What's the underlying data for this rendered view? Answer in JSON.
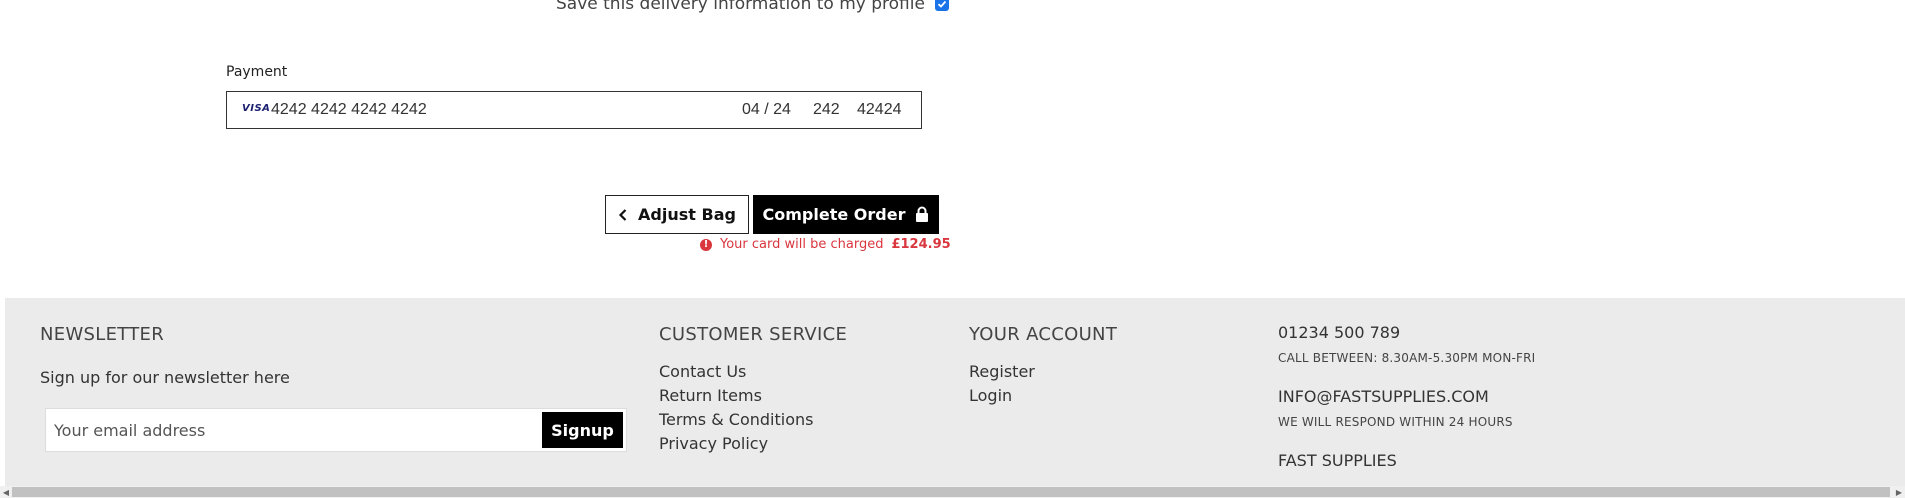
{
  "delivery": {
    "save_label": "Save this delivery information to my profile",
    "checked": true
  },
  "payment": {
    "title": "Payment",
    "card_brand": "VISA",
    "card_number": "4242 4242 4242 4242",
    "expiry": "04 / 24",
    "cvc": "242",
    "postcode": "42424"
  },
  "actions": {
    "adjust_label": "Adjust Bag",
    "complete_label": "Complete Order",
    "charge_text": "Your card will be charged",
    "charge_amount": "£124.95"
  },
  "footer": {
    "newsletter": {
      "heading": "NEWSLETTER",
      "text": "Sign up for our newsletter here",
      "placeholder": "Your email address",
      "button": "Signup"
    },
    "customer_service": {
      "heading": "CUSTOMER SERVICE",
      "links": [
        "Contact Us",
        "Return Items",
        "Terms & Conditions",
        "Privacy Policy"
      ]
    },
    "account": {
      "heading": "YOUR ACCOUNT",
      "links": [
        "Register",
        "Login"
      ]
    },
    "contact": {
      "phone": "01234 500 789",
      "phone_note": "CALL BETWEEN: 8.30AM-5.30PM MON-FRI",
      "email": "INFO@FASTSUPPLIES.COM",
      "email_note": "WE WILL RESPOND WITHIN 24 HOURS",
      "company": "FAST SUPPLIES"
    }
  },
  "colors": {
    "error": "#d9363e",
    "footer_bg": "#ebebeb",
    "checkbox": "#1a73e8"
  }
}
